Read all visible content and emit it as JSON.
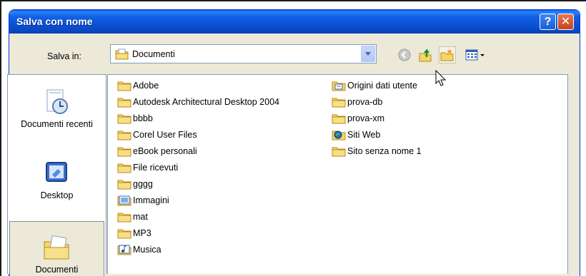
{
  "window": {
    "title": "Salva con nome",
    "help_glyph": "?",
    "close_glyph": "✕"
  },
  "toolbar": {
    "save_in_label": "Salva in:",
    "location": "Documenti",
    "buttons": [
      "back-icon",
      "up-folder-icon",
      "new-folder-icon",
      "views-menu-icon"
    ]
  },
  "places": [
    {
      "label": "Documenti recenti",
      "icon": "recent-documents-icon"
    },
    {
      "label": "Desktop",
      "icon": "desktop-icon"
    },
    {
      "label": "Documenti",
      "icon": "my-documents-icon"
    }
  ],
  "files": {
    "column1": [
      {
        "name": "Adobe",
        "icon": "folder-icon"
      },
      {
        "name": "Autodesk Architectural Desktop 2004",
        "icon": "folder-icon"
      },
      {
        "name": "bbbb",
        "icon": "folder-icon"
      },
      {
        "name": "Corel User Files",
        "icon": "folder-icon"
      },
      {
        "name": "eBook personali",
        "icon": "folder-icon"
      },
      {
        "name": "File ricevuti",
        "icon": "folder-icon"
      },
      {
        "name": "gggg",
        "icon": "folder-icon"
      },
      {
        "name": "Immagini",
        "icon": "pictures-folder-icon"
      },
      {
        "name": "mat",
        "icon": "folder-icon"
      },
      {
        "name": "MP3",
        "icon": "folder-icon"
      },
      {
        "name": "Musica",
        "icon": "music-folder-icon"
      }
    ],
    "column2": [
      {
        "name": "Origini dati utente",
        "icon": "data-sources-folder-icon"
      },
      {
        "name": "prova-db",
        "icon": "folder-icon"
      },
      {
        "name": "prova-xm",
        "icon": "folder-icon"
      },
      {
        "name": "Siti Web",
        "icon": "websites-folder-icon"
      },
      {
        "name": "Sito senza nome 1",
        "icon": "folder-icon"
      }
    ]
  },
  "colors": {
    "titlebar": "#0a4ecf",
    "dialog_bg": "#ece9d8",
    "folder": "#f5d66b",
    "close_button": "#c6421d"
  }
}
